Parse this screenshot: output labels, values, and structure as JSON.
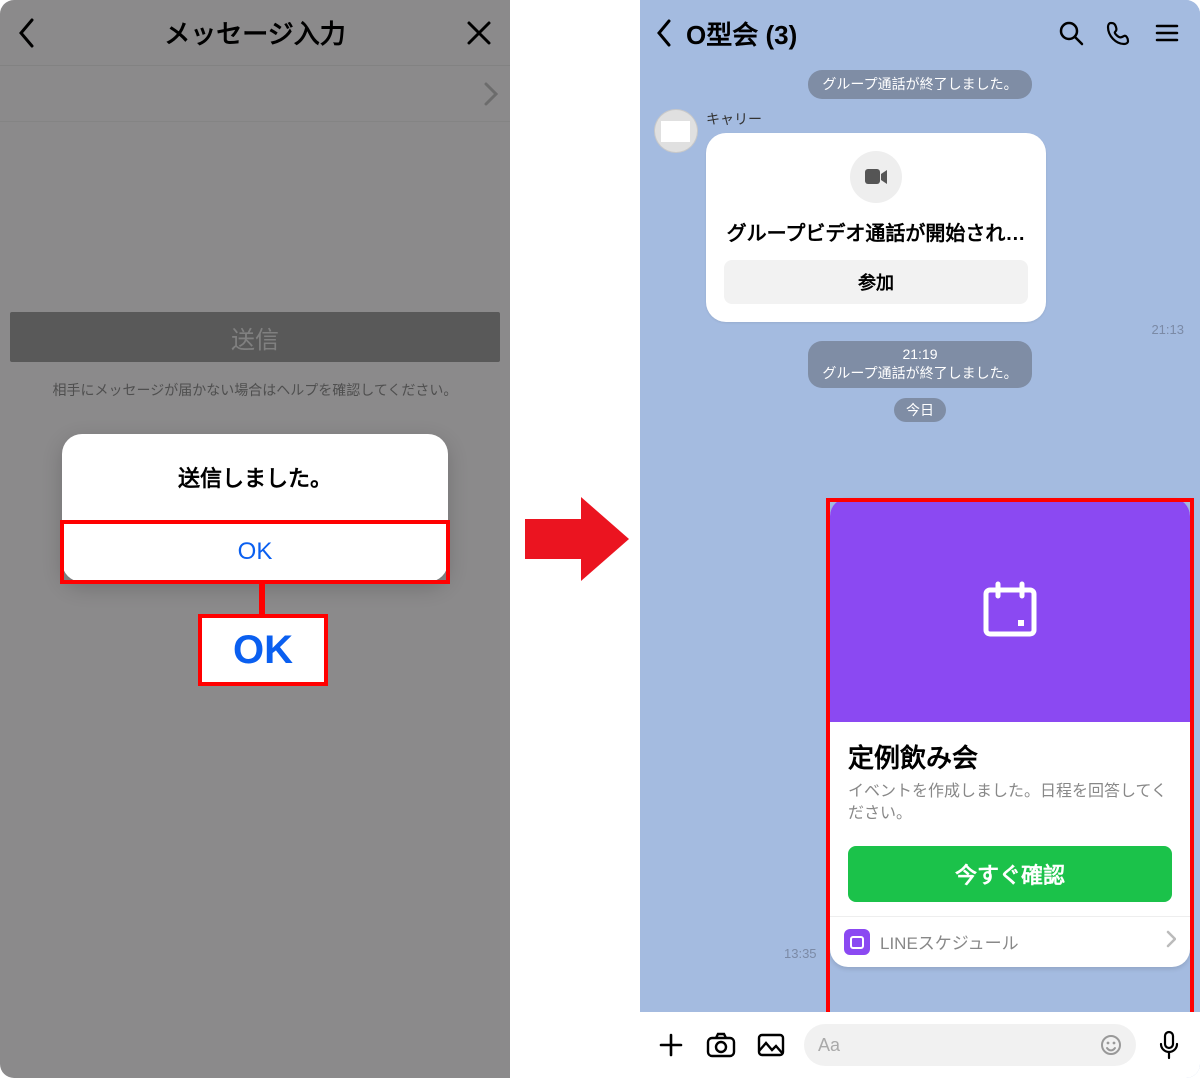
{
  "left": {
    "header_title": "メッセージ入力",
    "send_label": "送信",
    "hint": "相手にメッセージが届かない場合はヘルプを確認してください。",
    "dialog_msg": "送信しました。",
    "dialog_ok": "OK",
    "callout_ok": "OK"
  },
  "right": {
    "chat_title": "O型会 (3)",
    "sys_ended_1": "グループ通話が終了しました。",
    "sender": "キャリー",
    "video_title": "グループビデオ通話が開始され…",
    "join_label": "参加",
    "ts1": "21:13",
    "sys_time2": "21:19",
    "sys_ended_2": "グループ通話が終了しました。",
    "today": "今日",
    "event": {
      "title": "定例飲み会",
      "desc": "イベントを作成しました。日程を回答してください。",
      "cta": "今すぐ確認",
      "footer": "LINEスケジュール",
      "ts": "13:35"
    },
    "input_placeholder": "Aa"
  }
}
